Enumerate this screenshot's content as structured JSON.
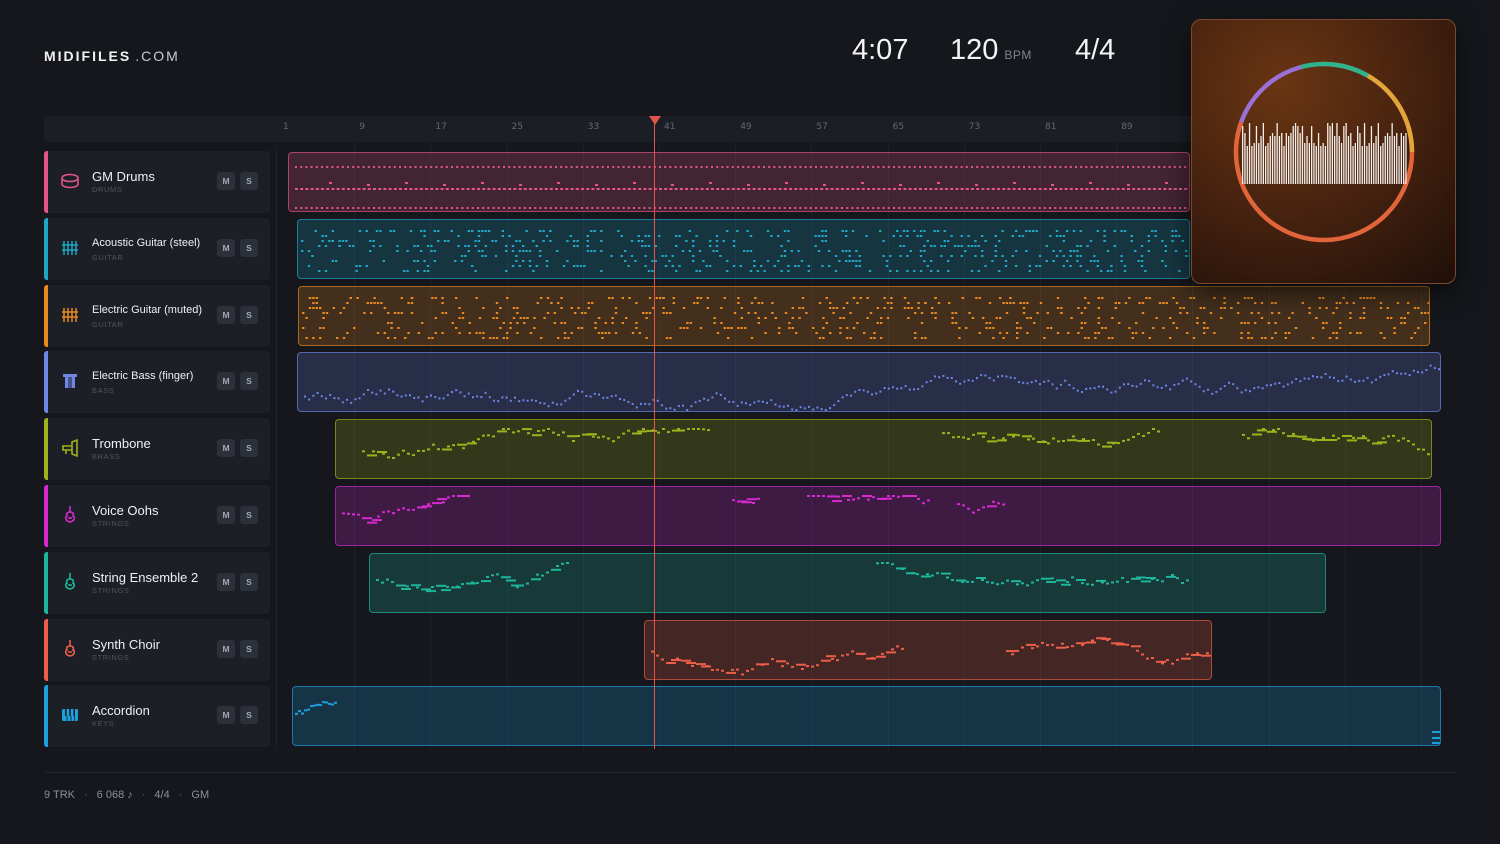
{
  "header": {
    "logo_bold": "MIDIFILES",
    "logo_light": ".COM",
    "time": "4:07",
    "tempo": "120",
    "tempo_unit": "BPM",
    "time_signature": "4/4"
  },
  "ruler": {
    "ticks": [
      "1",
      "9",
      "17",
      "25",
      "33",
      "41",
      "49",
      "57",
      "65",
      "73",
      "81",
      "89"
    ]
  },
  "tracks": [
    {
      "name": "GM Drums",
      "category": "DRUMS",
      "color": "#e25586",
      "icon": "drum-icon",
      "mute": "M",
      "solo": "S"
    },
    {
      "name": "Acoustic Guitar (steel)",
      "category": "GUITAR",
      "color": "#1ea6c4",
      "icon": "guitar-icon",
      "mute": "M",
      "solo": "S"
    },
    {
      "name": "Electric Guitar (muted)",
      "category": "GUITAR",
      "color": "#e88a1e",
      "icon": "guitar-icon",
      "mute": "M",
      "solo": "S"
    },
    {
      "name": "Electric Bass (finger)",
      "category": "BASS",
      "color": "#6f86e6",
      "icon": "bass-icon",
      "mute": "M",
      "solo": "S"
    },
    {
      "name": "Trombone",
      "category": "BRASS",
      "color": "#9fb21c",
      "icon": "trombone-icon",
      "mute": "M",
      "solo": "S"
    },
    {
      "name": "Voice Oohs",
      "category": "STRINGS",
      "color": "#d629d0",
      "icon": "violin-icon",
      "mute": "M",
      "solo": "S"
    },
    {
      "name": "String Ensemble 2",
      "category": "STRINGS",
      "color": "#1eb59c",
      "icon": "violin-icon",
      "mute": "M",
      "solo": "S"
    },
    {
      "name": "Synth Choir",
      "category": "STRINGS",
      "color": "#ec5e49",
      "icon": "violin-icon",
      "mute": "M",
      "solo": "S"
    },
    {
      "name": "Accordion",
      "category": "KEYS",
      "color": "#1e9fe0",
      "icon": "keyboard-icon",
      "mute": "M",
      "solo": "S"
    }
  ],
  "footer": {
    "tracks": "9 TRK",
    "notes": "6 068 ♪",
    "signature": "4/4",
    "standard": "GM"
  },
  "cover_art": {
    "ring_colors": [
      "#e2643a",
      "#e2643a",
      "#9b6fd8",
      "#2fb38d",
      "#e2a53a"
    ]
  }
}
